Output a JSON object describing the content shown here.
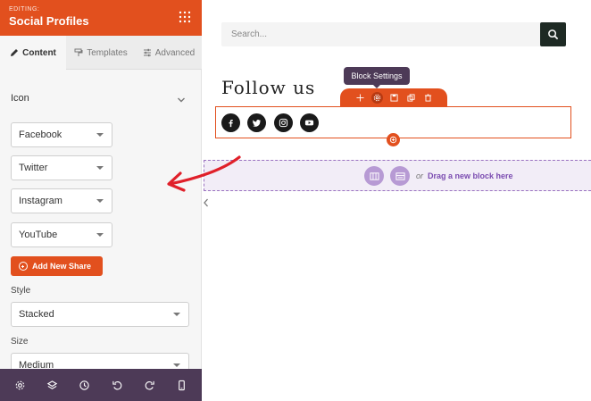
{
  "sidebar": {
    "editing_label": "EDITING:",
    "title": "Social Profiles",
    "tabs": [
      {
        "label": "Content",
        "icon": "pencil-icon",
        "active": true
      },
      {
        "label": "Templates",
        "icon": "paint-roller-icon",
        "active": false
      },
      {
        "label": "Advanced",
        "icon": "sliders-icon",
        "active": false
      }
    ],
    "section_title": "Icon",
    "shares": [
      "Facebook",
      "Twitter",
      "Instagram",
      "YouTube"
    ],
    "add_share_label": "Add New Share",
    "style_label": "Style",
    "style_value": "Stacked",
    "size_label": "Size",
    "size_value": "Medium",
    "toolbar_icons": [
      "gear-icon",
      "layers-icon",
      "history-icon",
      "undo-icon",
      "redo-icon",
      "mobile-preview-icon"
    ]
  },
  "canvas": {
    "search": {
      "placeholder": "Search..."
    },
    "heading": "Follow us",
    "tooltip": "Block Settings",
    "block_actions": [
      "move-icon",
      "settings-icon",
      "save-icon",
      "duplicate-icon",
      "delete-icon"
    ],
    "social_icons": [
      "facebook-icon",
      "twitter-icon",
      "instagram-icon",
      "youtube-icon"
    ],
    "drop_zone": {
      "or_text": "or",
      "label": "Drag a new block here"
    }
  },
  "colors": {
    "accent": "#e2501e",
    "toolbar": "#4d3a57",
    "drop_zone": "#f2edf7",
    "drop_text": "#7a4bb0"
  }
}
